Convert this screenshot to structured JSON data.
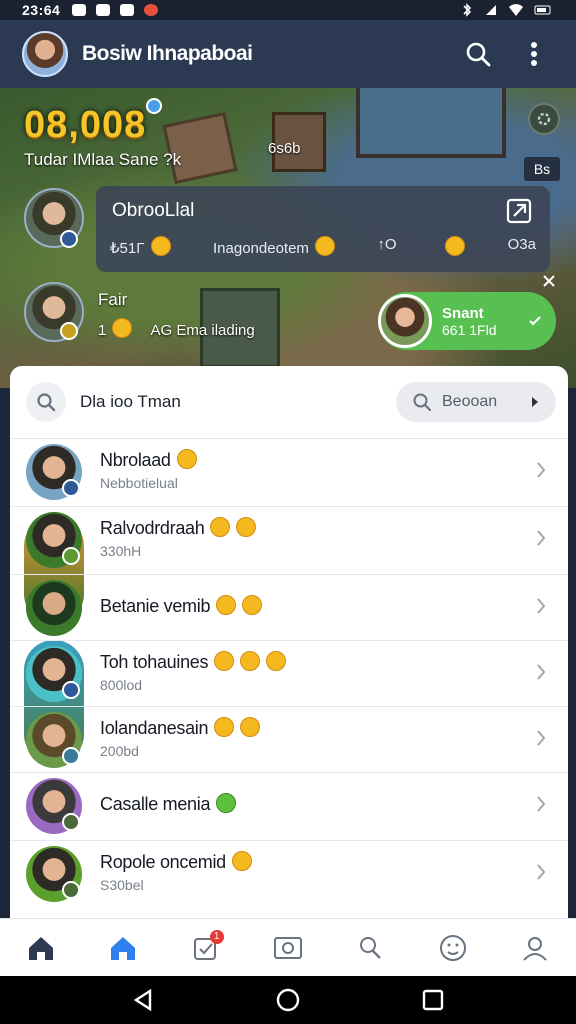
{
  "status_bar": {
    "time": "23:64"
  },
  "header": {
    "title": "Bosiw Ihnapaboai"
  },
  "game": {
    "score": "08,008",
    "subtitle": "Tudar IMlaa Sane ?k",
    "mid_label": "6s6b",
    "corner_tag": "Bs"
  },
  "notice": {
    "title": "ObrooLlal",
    "stat_left": "₺51Γ",
    "stat_mid": "Inagondeotem",
    "stat_after": "↑O",
    "stat_right": "O3a"
  },
  "friend": {
    "name": "Fair",
    "count": "1",
    "activity": "AG Ema ilading"
  },
  "status_pill": {
    "title": "Snant",
    "subtitle": "661 1Fld"
  },
  "panel": {
    "search_label": "Dla ioo Tman",
    "search_button": "Beooan",
    "items": [
      {
        "name": "Nbrolaad",
        "sub": "Nebbotielual"
      },
      {
        "name": "Ralvodrdraah",
        "sub": "330hH"
      },
      {
        "name": "Betanie vemib",
        "sub": ""
      },
      {
        "name": "Toh tohauines",
        "sub": "800lod"
      },
      {
        "name": "Iolandanesain",
        "sub": "200bd"
      },
      {
        "name": "Casalle menia",
        "sub": ""
      },
      {
        "name": "Ropole oncemid",
        "sub": "S30bel"
      }
    ]
  },
  "bottom_nav": {
    "badge": "1"
  },
  "colors": {
    "accent": "#2f80ed",
    "pill": "#58c050",
    "score": "#f5c52a"
  }
}
